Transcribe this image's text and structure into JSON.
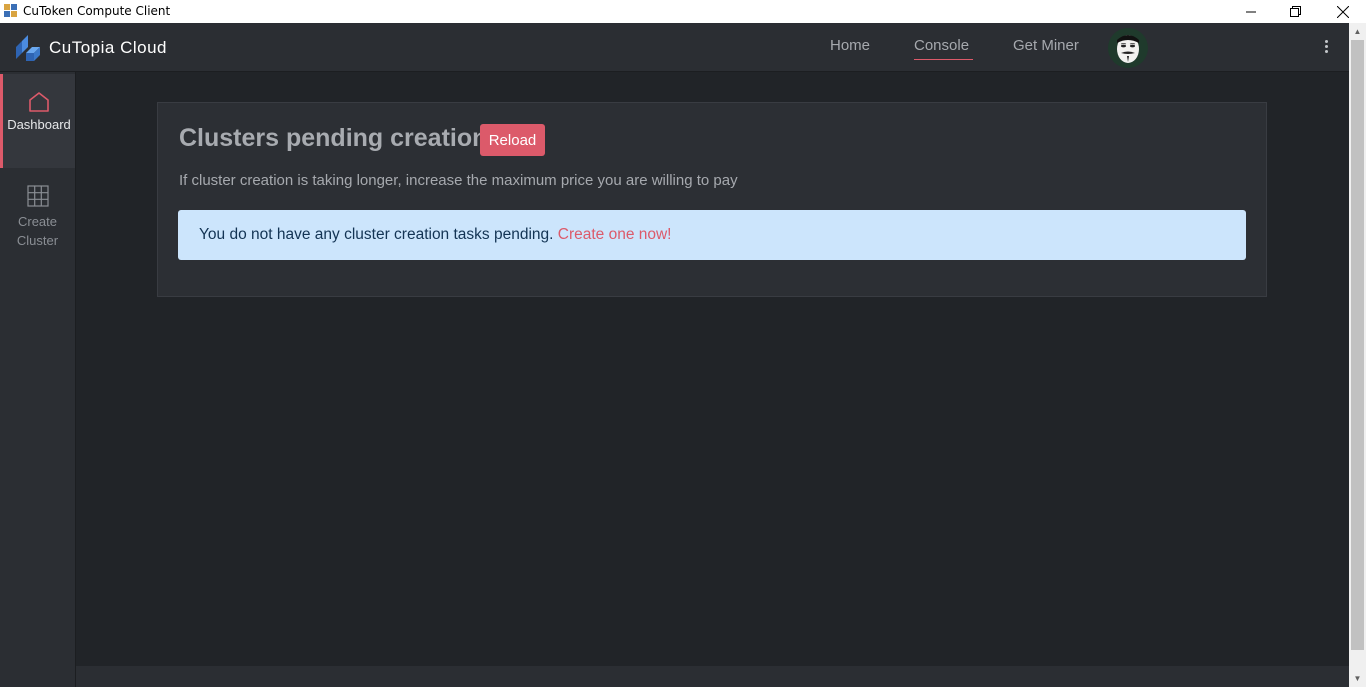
{
  "window": {
    "title": "CuToken Compute Client",
    "controls": [
      "minimize-icon",
      "restore-icon",
      "close-icon"
    ]
  },
  "brand": {
    "name": "CuTopia Cloud",
    "logo_icon": "cutopia-logo-icon"
  },
  "nav": {
    "links": [
      {
        "label": "Home",
        "active": false
      },
      {
        "label": "Console",
        "active": true
      },
      {
        "label": "Get Miner",
        "active": false
      }
    ],
    "menu_icon": "kebab-menu-icon",
    "avatar_icon": "user-avatar-mask-icon"
  },
  "sidebar": {
    "items": [
      {
        "label": "Dashboard",
        "icon": "home-icon",
        "active": true
      },
      {
        "label": "Create Cluster",
        "icon": "grid-icon",
        "active": false
      }
    ]
  },
  "main": {
    "title": "Clusters pending creation",
    "reload_label": "Reload",
    "subtitle": "If cluster creation is taking longer, increase the maximum price you are willing to pay",
    "alert_text": "You do not have any cluster creation tasks pending. ",
    "alert_link": "Create one now!"
  },
  "colors": {
    "accent": "#dc5a6a",
    "background": "#212428",
    "panel": "#2c2f34",
    "alert_bg": "#cce5fc",
    "alert_text": "#133454"
  }
}
